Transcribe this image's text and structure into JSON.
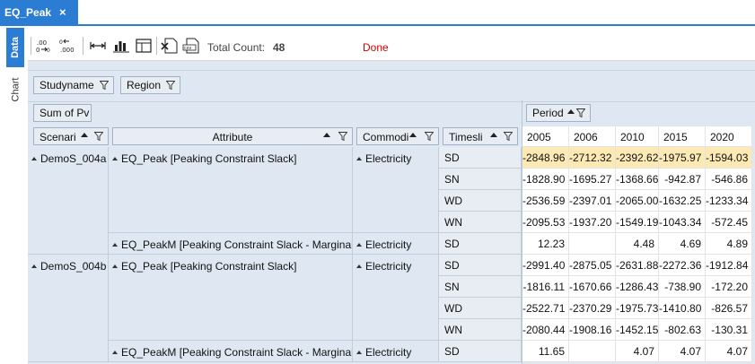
{
  "document_tab": {
    "title": "EQ_Peak",
    "close_glyph": "×"
  },
  "side_tabs": {
    "data": "Data",
    "chart": "Chart"
  },
  "toolbar": {
    "icons": [
      "decimal-increase-icon",
      "decimal-decrease-icon",
      "column-width-icon",
      "bar-chart-icon",
      "table-layout-icon",
      "excel-export-icon",
      "csv-export-icon"
    ],
    "total_count_label": "Total Count:",
    "total_count_value": "48",
    "status": "Done"
  },
  "filters": [
    "Studyname",
    "Region"
  ],
  "data_field": "Sum of Pv",
  "column_field": "Period",
  "row_headers": [
    "Scenari",
    "Attribute",
    "Commodi",
    "Timesli"
  ],
  "years": [
    "2005",
    "2006",
    "2010",
    "2015",
    "2020"
  ],
  "groups": [
    {
      "scenario": "DemoS_004a",
      "blocks": [
        {
          "attribute": "EQ_Peak [Peaking Constraint Slack]",
          "commodity": "Electricity",
          "rows": [
            {
              "ts": "SD",
              "v": [
                "-2848.96",
                "-2712.32",
                "-2392.62",
                "-1975.97",
                "-1594.03"
              ]
            },
            {
              "ts": "SN",
              "v": [
                "-1828.90",
                "-1695.27",
                "-1368.66",
                "-942.87",
                "-546.86"
              ]
            },
            {
              "ts": "WD",
              "v": [
                "-2536.59",
                "-2397.01",
                "-2065.00",
                "-1632.25",
                "-1233.34"
              ]
            },
            {
              "ts": "WN",
              "v": [
                "-2095.53",
                "-1937.20",
                "-1549.19",
                "-1043.34",
                "-572.45"
              ]
            }
          ]
        },
        {
          "attribute": "EQ_PeakM [Peaking Constraint Slack - Marginals]",
          "commodity": "Electricity",
          "rows": [
            {
              "ts": "SD",
              "v": [
                "12.23",
                "",
                "4.48",
                "4.69",
                "4.89"
              ]
            }
          ]
        }
      ]
    },
    {
      "scenario": "DemoS_004b",
      "blocks": [
        {
          "attribute": "EQ_Peak [Peaking Constraint Slack]",
          "commodity": "Electricity",
          "rows": [
            {
              "ts": "SD",
              "v": [
                "-2991.40",
                "-2875.05",
                "-2631.88",
                "-2272.36",
                "-1912.84"
              ]
            },
            {
              "ts": "SN",
              "v": [
                "-1816.11",
                "-1670.66",
                "-1286.43",
                "-738.90",
                "-172.20"
              ]
            },
            {
              "ts": "WD",
              "v": [
                "-2522.71",
                "-2370.29",
                "-1975.73",
                "-1410.80",
                "-826.57"
              ]
            },
            {
              "ts": "WN",
              "v": [
                "-2080.44",
                "-1908.16",
                "-1452.15",
                "-802.63",
                "-130.31"
              ]
            }
          ]
        },
        {
          "attribute": "EQ_PeakM [Peaking Constraint Slack - Marginals]",
          "commodity": "Electricity",
          "rows": [
            {
              "ts": "SD",
              "v": [
                "11.65",
                "",
                "4.07",
                "4.07",
                "4.07"
              ]
            }
          ]
        }
      ]
    }
  ],
  "colors": {
    "accent": "#2b7cd3",
    "highlight_row": "#fde9b4",
    "status_red": "#d40000",
    "pivot_bg": "#dfe8f2"
  }
}
